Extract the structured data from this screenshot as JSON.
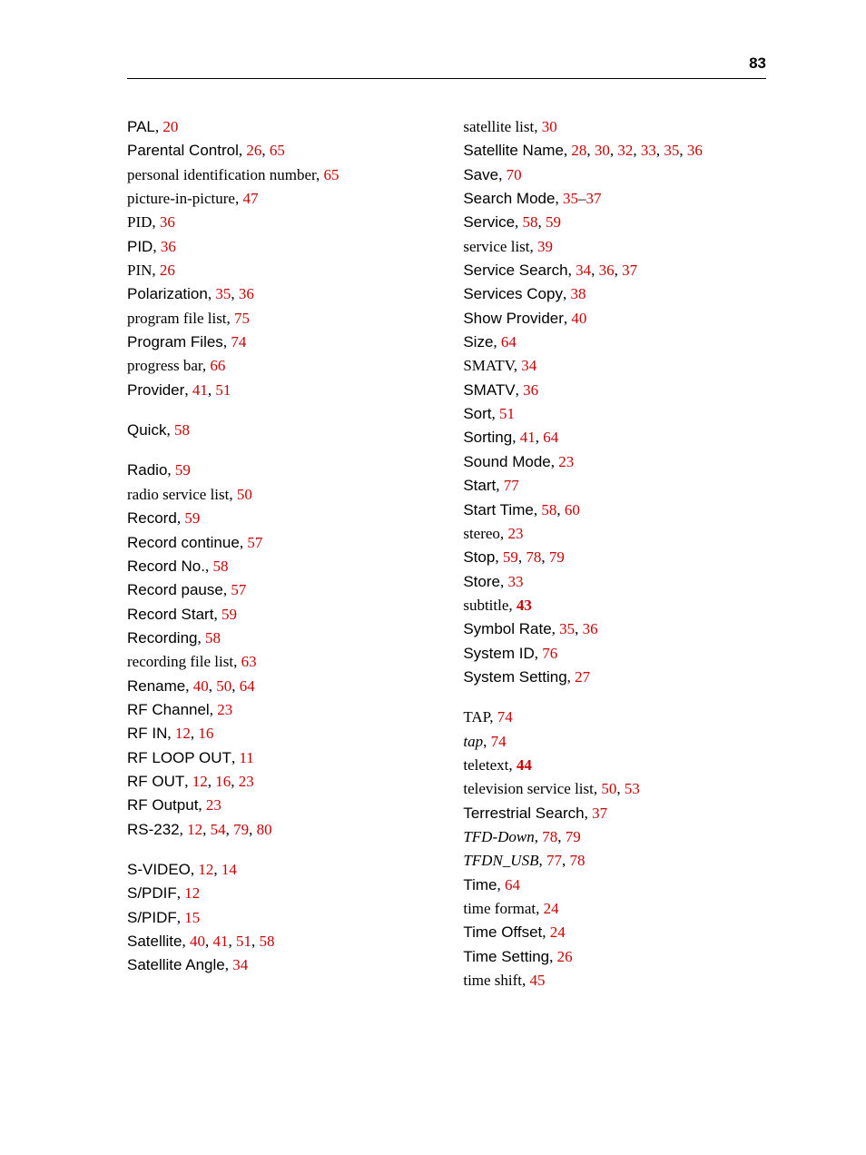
{
  "page_number": "83",
  "left_column": [
    {
      "html": "<span class='sans'>PAL</span>, <span class='link'>20</span>"
    },
    {
      "html": "<span class='sans'>Parental Control</span>, <span class='link'>26</span>, <span class='link'>65</span>"
    },
    {
      "html": "personal identification number, <span class='link'>65</span>"
    },
    {
      "html": "picture-in-picture, <span class='link'>47</span>"
    },
    {
      "html": "PID, <span class='link'>36</span>"
    },
    {
      "html": "<span class='sans'>PID</span>, <span class='link'>36</span>"
    },
    {
      "html": "PIN, <span class='link'>26</span>"
    },
    {
      "html": "<span class='sans'>Polarization</span>, <span class='link'>35</span>, <span class='link'>36</span>"
    },
    {
      "html": "program file list, <span class='link'>75</span>"
    },
    {
      "html": "<span class='sans'>Program Files</span>, <span class='link'>74</span>"
    },
    {
      "html": "progress bar, <span class='link'>66</span>"
    },
    {
      "html": "<span class='sans'>Provider</span>, <span class='link'>41</span>, <span class='link'>51</span>"
    },
    {
      "html": "<span class='sans'>Quick</span>, <span class='link'>58</span>",
      "gap": true
    },
    {
      "html": "<span class='sans'>Radio</span>, <span class='link'>59</span>",
      "gap": true
    },
    {
      "html": "radio service list, <span class='link'>50</span>"
    },
    {
      "html": "<span class='sans'>Record</span>, <span class='link'>59</span>"
    },
    {
      "html": "<span class='sans'>Record continue</span>, <span class='link'>57</span>"
    },
    {
      "html": "<span class='sans'>Record No.</span>, <span class='link'>58</span>"
    },
    {
      "html": "<span class='sans'>Record pause</span>, <span class='link'>57</span>"
    },
    {
      "html": "<span class='sans'>Record Start</span>, <span class='link'>59</span>"
    },
    {
      "html": "<span class='sans'>Recording</span>, <span class='link'>58</span>"
    },
    {
      "html": "recording file list, <span class='link'>63</span>"
    },
    {
      "html": "<span class='sans'>Rename</span>, <span class='link'>40</span>, <span class='link'>50</span>, <span class='link'>64</span>"
    },
    {
      "html": "<span class='sans'>RF Channel</span>, <span class='link'>23</span>"
    },
    {
      "html": "<span class='sans'>RF IN</span>, <span class='link'>12</span>, <span class='link'>16</span>"
    },
    {
      "html": "<span class='sans'>RF LOOP OUT</span>, <span class='link'>11</span>"
    },
    {
      "html": "<span class='sans'>RF OUT</span>, <span class='link'>12</span>, <span class='link'>16</span>, <span class='link'>23</span>"
    },
    {
      "html": "<span class='sans'>RF Output</span>, <span class='link'>23</span>"
    },
    {
      "html": "<span class='sans'>RS-232</span>, <span class='link'>12</span>, <span class='link'>54</span>, <span class='link'>79</span>, <span class='link'>80</span>"
    },
    {
      "html": "<span class='sans'>S-VIDEO</span>, <span class='link'>12</span>, <span class='link'>14</span>",
      "gap": true
    },
    {
      "html": "<span class='sans'>S/PDIF</span>, <span class='link'>12</span>"
    },
    {
      "html": "<span class='sans'>S/PIDF</span>, <span class='link'>15</span>"
    },
    {
      "html": "<span class='sans'>Satellite</span>, <span class='link'>40</span>, <span class='link'>41</span>, <span class='link'>51</span>, <span class='link'>58</span>"
    },
    {
      "html": "<span class='sans'>Satellite Angle</span>, <span class='link'>34</span>"
    }
  ],
  "right_column": [
    {
      "html": "satellite list, <span class='link'>30</span>"
    },
    {
      "html": "<span class='sans'>Satellite Name</span>, <span class='link'>28</span>, <span class='link'>30</span>, <span class='link'>32</span>, <span class='link'>33</span>, <span class='link'>35</span>, <span class='link'>36</span>"
    },
    {
      "html": "<span class='sans'>Save</span>, <span class='link'>70</span>"
    },
    {
      "html": "<span class='sans'>Search Mode</span>, <span class='link'>35</span>–<span class='link'>37</span>"
    },
    {
      "html": "<span class='sans'>Service</span>, <span class='link'>58</span>, <span class='link'>59</span>"
    },
    {
      "html": "service list, <span class='link'>39</span>"
    },
    {
      "html": "<span class='sans'>Service Search</span>, <span class='link'>34</span>, <span class='link'>36</span>, <span class='link'>37</span>"
    },
    {
      "html": "<span class='sans'>Services Copy</span>, <span class='link'>38</span>"
    },
    {
      "html": "<span class='sans'>Show Provider</span>, <span class='link'>40</span>"
    },
    {
      "html": "<span class='sans'>Size</span>, <span class='link'>64</span>"
    },
    {
      "html": "SMATV, <span class='link'>34</span>"
    },
    {
      "html": "<span class='sans'>SMATV</span>, <span class='link'>36</span>"
    },
    {
      "html": "<span class='sans'>Sort</span>, <span class='link'>51</span>"
    },
    {
      "html": "<span class='sans'>Sorting</span>, <span class='link'>41</span>, <span class='link'>64</span>"
    },
    {
      "html": "<span class='sans'>Sound Mode</span>, <span class='link'>23</span>"
    },
    {
      "html": "<span class='sans'>Start</span>, <span class='link'>77</span>"
    },
    {
      "html": "<span class='sans'>Start Time</span>, <span class='link'>58</span>, <span class='link'>60</span>"
    },
    {
      "html": "stereo, <span class='link'>23</span>"
    },
    {
      "html": "<span class='sans'>Stop</span>, <span class='link'>59</span>, <span class='link'>78</span>, <span class='link'>79</span>"
    },
    {
      "html": "<span class='sans'>Store</span>, <span class='link'>33</span>"
    },
    {
      "html": "subtitle, <span class='link bold'>43</span>"
    },
    {
      "html": "<span class='sans'>Symbol Rate</span>, <span class='link'>35</span>, <span class='link'>36</span>"
    },
    {
      "html": "<span class='sans'>System ID</span>, <span class='link'>76</span>"
    },
    {
      "html": "<span class='sans'>System Setting</span>, <span class='link'>27</span>"
    },
    {
      "html": "TAP, <span class='link'>74</span>",
      "gap": true
    },
    {
      "html": "<span class='ital'>tap</span>, <span class='link'>74</span>"
    },
    {
      "html": "teletext, <span class='link bold'>44</span>"
    },
    {
      "html": "television service list, <span class='link'>50</span>, <span class='link'>53</span>"
    },
    {
      "html": "<span class='sans'>Terrestrial Search</span>, <span class='link'>37</span>"
    },
    {
      "html": "<span class='ital'>TFD-Down</span>, <span class='link'>78</span>, <span class='link'>79</span>"
    },
    {
      "html": "<span class='ital'>TFDN_USB</span>, <span class='link'>77</span>, <span class='link'>78</span>"
    },
    {
      "html": "<span class='sans'>Time</span>, <span class='link'>64</span>"
    },
    {
      "html": "time format, <span class='link'>24</span>"
    },
    {
      "html": "<span class='sans'>Time Offset</span>, <span class='link'>24</span>"
    },
    {
      "html": "<span class='sans'>Time Setting</span>, <span class='link'>26</span>"
    },
    {
      "html": "time shift, <span class='link'>45</span>"
    }
  ]
}
